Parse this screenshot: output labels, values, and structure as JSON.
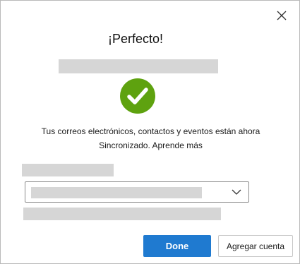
{
  "dialog": {
    "title": "¡Perfecto!",
    "message_line1": "Tus correos electrónicos, contactos y eventos están ahora",
    "message_line2_prefix": "Sincronizado. ",
    "learn_more_label": "Aprende más",
    "success_icon": "check-circle-icon",
    "close_icon": "close-icon",
    "success_color": "#5ea20f",
    "primary_color": "#1f7ad0"
  },
  "account_select": {
    "chevron_icon": "chevron-down-icon"
  },
  "buttons": {
    "done_label": "Done",
    "add_account_label": "Agregar cuenta"
  }
}
